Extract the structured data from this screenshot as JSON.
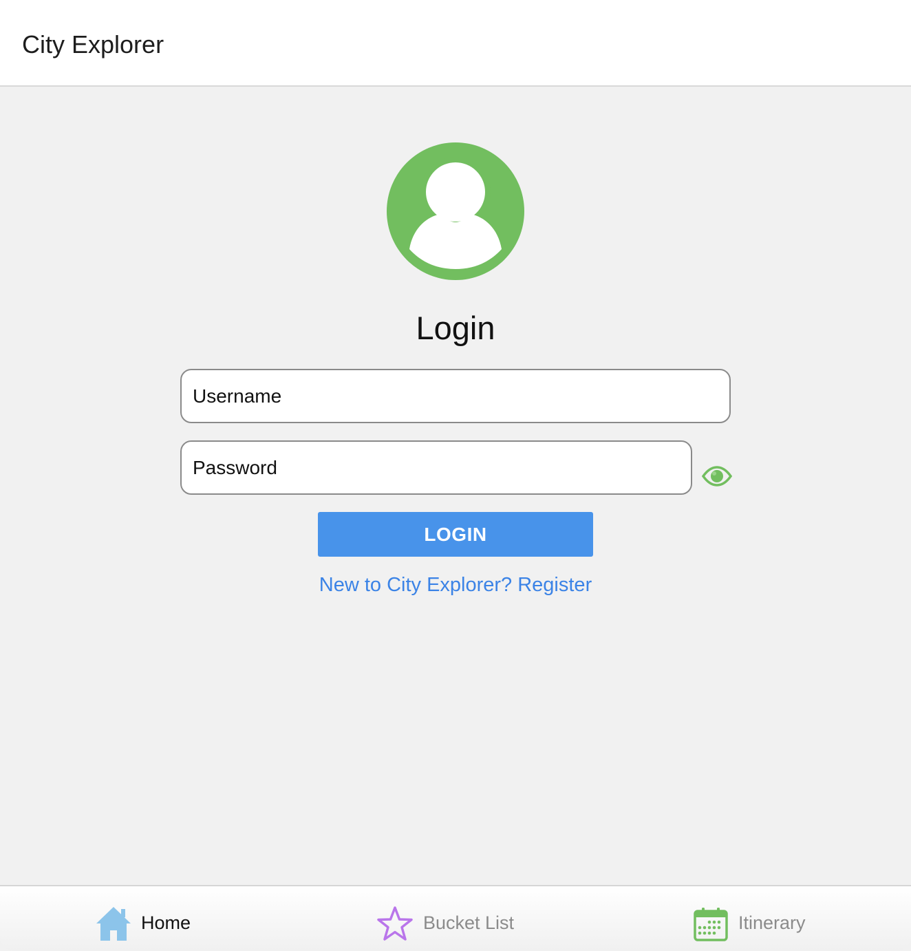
{
  "header": {
    "title": "City Explorer"
  },
  "login": {
    "heading": "Login",
    "username_placeholder": "Username",
    "password_placeholder": "Password",
    "button_label": "LOGIN",
    "register_link": "New to City Explorer? Register"
  },
  "icons": {
    "avatar": "user-avatar-icon",
    "password_toggle": "eye-icon",
    "home": "house-icon",
    "bucket_list": "star-icon",
    "itinerary": "calendar-icon"
  },
  "tabs": [
    {
      "label": "Home",
      "active": true
    },
    {
      "label": "Bucket List",
      "active": false
    },
    {
      "label": "Itinerary",
      "active": false
    }
  ],
  "colors": {
    "accent_green": "#72be5f",
    "button_blue": "#4893ea",
    "link_blue": "#3b83e6",
    "home_icon": "#8cc4ea",
    "star_icon": "#b975ea"
  }
}
